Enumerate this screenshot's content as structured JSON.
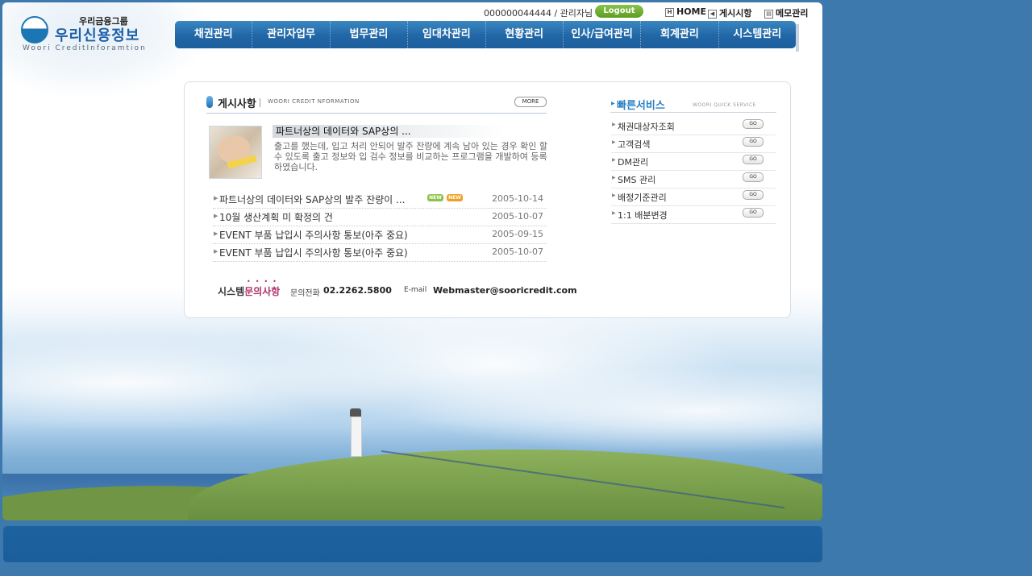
{
  "brand": {
    "group": "우리금융그룹",
    "name": "우리신용정보",
    "english": "Woori CreditInforamtion"
  },
  "topbar": {
    "user": "000000044444 / 관리자님",
    "logout": "Logout",
    "home": "HOME",
    "board": "게시시항",
    "memo": "메모관리"
  },
  "menu": [
    "채권관리",
    "관리자업무",
    "법무관리",
    "임대차관리",
    "현황관리",
    "인사/급여관리",
    "회계관리",
    "시스템관리"
  ],
  "notice": {
    "title": "게시사항",
    "subtitle": "WOORI CREDIT NFORMATION",
    "more": "MORE",
    "featured_title": "파트너상의 데이터와 SAP상의 ...",
    "featured_body": "출고를 했는데, 입고 처리 안되어 발주 잔량에 계속 남아 있는  경우 확인 할 수 있도록 출고 정보와 입 검수 정보를 비교하는 프로그램을 개발하여 등록 하였습니다.",
    "items": [
      {
        "title": "파트너상의 데이터와 SAP상의 발주 잔량이 ...",
        "date": "2005-10-14",
        "badges": [
          "NEW",
          "NEW"
        ]
      },
      {
        "title": "10월 생산계획 미 확정의 건",
        "date": "2005-10-07"
      },
      {
        "title": "EVENT 부품 납입시 주의사항 통보(아주 중요)",
        "date": "2005-09-15"
      },
      {
        "title": "EVENT 부품 납입시 주의사항 통보(아주 중요)",
        "date": "2005-10-07"
      }
    ]
  },
  "quick": {
    "title": "빠른서비스",
    "subtitle": "WOORI QUICK SERVICE",
    "go": "GO",
    "items": [
      "채권대상자조회",
      "고객검색",
      "DM관리",
      "SMS 관리",
      "배정기준관리",
      "1:1 배분변경"
    ]
  },
  "contact": {
    "label_a": "시스템",
    "label_b": "문의사항",
    "phone_label": "문의전화",
    "phone": "02.2262.5800",
    "email_label": "E-mail",
    "email": "Webmaster@sooricredit.com"
  },
  "colors": {
    "background": "#3d79ad",
    "menu": "#2166a6",
    "accent": "#2a7fc6",
    "footer": "#1a5e9a"
  }
}
